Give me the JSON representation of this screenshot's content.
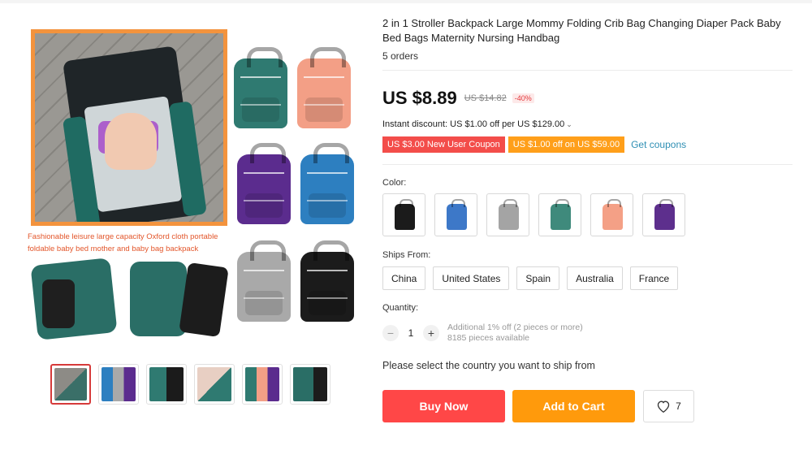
{
  "product": {
    "title": "2 in 1 Stroller Backpack Large Mommy Folding Crib Bag Changing Diaper Pack Baby Bed Bags Maternity Nursing Handbag",
    "orders": "5 orders",
    "price": "US $8.89",
    "old_price": "US $14.82",
    "discount_badge": "-40%",
    "instant_discount": "Instant discount: US $1.00 off per US $129.00",
    "coupons": [
      {
        "label": "US $3.00 New User Coupon",
        "color": "#f34d4a"
      },
      {
        "label": "US $1.00 off on US $59.00",
        "color": "#ff9f1a"
      }
    ],
    "get_coupons_label": "Get coupons"
  },
  "gallery": {
    "caption": "Fashionable leisure large capacity Oxford cloth portable foldable baby bed mother and baby bag backpack",
    "bag_colors": [
      "#2f7a71",
      "#f39f86",
      "#5b2c8e",
      "#2d7fc0",
      "#a9a9a9",
      "#1b1b1b"
    ],
    "thumbnails_count": 6
  },
  "options": {
    "color_label": "Color:",
    "colors": [
      {
        "name": "black",
        "hex": "#1b1b1b"
      },
      {
        "name": "blue",
        "hex": "#3d78c8"
      },
      {
        "name": "gray",
        "hex": "#a4a4a4"
      },
      {
        "name": "green",
        "hex": "#3f8a7c"
      },
      {
        "name": "pink",
        "hex": "#f4a086"
      },
      {
        "name": "purple",
        "hex": "#5d2f8d"
      }
    ],
    "ships_label": "Ships From:",
    "ships": [
      "China",
      "United States",
      "Spain",
      "Australia",
      "France"
    ],
    "quantity_label": "Quantity:",
    "quantity_value": "1",
    "quantity_note_1": "Additional 1% off (2 pieces or more)",
    "quantity_note_2": "8185 pieces available",
    "select_message": "Please select the country you want to ship from"
  },
  "actions": {
    "buy_now": "Buy Now",
    "add_to_cart": "Add to Cart",
    "wishlist_count": "7"
  },
  "icons": {
    "heart": "heart-icon",
    "minus": "minus-icon",
    "plus": "plus-icon",
    "caret": "chevron-down-icon"
  }
}
